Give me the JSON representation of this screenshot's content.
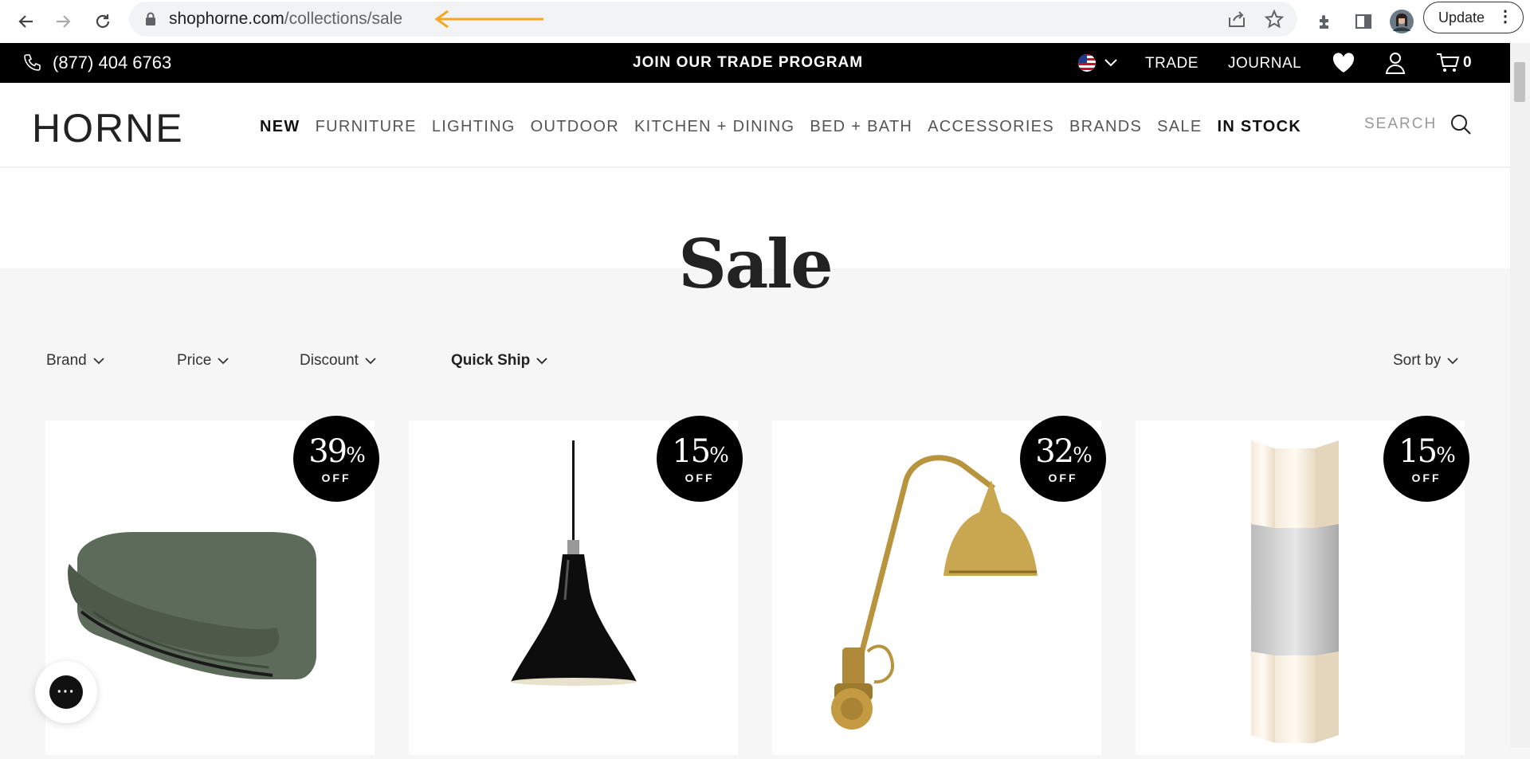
{
  "browser": {
    "url_domain": "shophorne.com",
    "url_path": "/collections/sale",
    "update_label": "Update"
  },
  "topbar": {
    "phone": "(877) 404 6763",
    "promo": "JOIN OUR TRADE PROGRAM",
    "trade": "TRADE",
    "journal": "JOURNAL",
    "cart_count": "0"
  },
  "header": {
    "logo": "HORNE",
    "nav": [
      {
        "label": "NEW",
        "bold": true
      },
      {
        "label": "FURNITURE",
        "bold": false
      },
      {
        "label": "LIGHTING",
        "bold": false
      },
      {
        "label": "OUTDOOR",
        "bold": false
      },
      {
        "label": "KITCHEN + DINING",
        "bold": false
      },
      {
        "label": "BED + BATH",
        "bold": false
      },
      {
        "label": "ACCESSORIES",
        "bold": false
      },
      {
        "label": "BRANDS",
        "bold": false
      },
      {
        "label": "SALE",
        "bold": false
      },
      {
        "label": "IN STOCK",
        "bold": true
      }
    ],
    "search_label": "SEARCH"
  },
  "page": {
    "title": "Sale"
  },
  "filters": {
    "brand": "Brand",
    "price": "Price",
    "discount": "Discount",
    "quick_ship": "Quick Ship",
    "sort_by": "Sort by"
  },
  "products": [
    {
      "discount": "39",
      "unit": "%",
      "off": "OFF",
      "kind": "sofa"
    },
    {
      "discount": "15",
      "unit": "%",
      "off": "OFF",
      "kind": "pendant"
    },
    {
      "discount": "32",
      "unit": "%",
      "off": "OFF",
      "kind": "wall-lamp"
    },
    {
      "discount": "15",
      "unit": "%",
      "off": "OFF",
      "kind": "sconce"
    }
  ],
  "colors": {
    "accent_arrow": "#f5a623",
    "topbar_bg": "#000000",
    "page_bg": "#f6f6f6"
  }
}
